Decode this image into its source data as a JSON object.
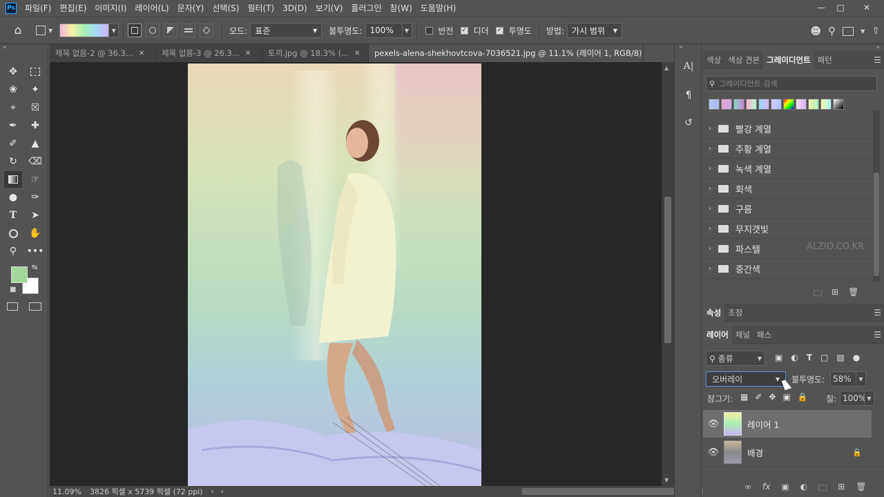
{
  "app": {
    "logo": "Ps"
  },
  "menu": [
    "파일(F)",
    "편집(E)",
    "이미지(I)",
    "레이어(L)",
    "문자(Y)",
    "선택(S)",
    "필터(T)",
    "3D(D)",
    "보기(V)",
    "플러그인",
    "창(W)",
    "도움말(H)"
  ],
  "options": {
    "mode_label": "모드:",
    "mode_value": "표준",
    "opacity_label": "불투명도:",
    "opacity_value": "100%",
    "reverse_label": "반전",
    "dither_label": "디더",
    "transparency_label": "투명도",
    "method_label": "방법:",
    "method_value": "가시 범위"
  },
  "tabs": [
    {
      "label": "제목 없음-2 @ 36.3...",
      "active": false
    },
    {
      "label": "제목 없음-3 @ 26.3...",
      "active": false
    },
    {
      "label": "토끼.jpg @ 18.3% (...",
      "active": false
    },
    {
      "label": "pexels-alena-shekhovtcova-7036521.jpg @ 11.1% (레이어 1, RGB/8) *",
      "active": true
    }
  ],
  "status": {
    "zoom": "11.09%",
    "info": "3826 픽셀 x 5739 픽셀 (72 ppi)"
  },
  "swatches_panel": {
    "tabs": [
      "색상",
      "색상 견본",
      "그레이디언트",
      "패턴"
    ],
    "active_tab": "그레이디언트",
    "search_placeholder": "그레이디언트 검색",
    "folders": [
      "빨강 계열",
      "주황 계열",
      "녹색 계열",
      "회색",
      "구름",
      "무지갯빛",
      "파스텔",
      "중간색"
    ],
    "watermark": "ALZIO.CO.KR"
  },
  "props_panel": {
    "tabs": [
      "속성",
      "조정"
    ],
    "active_tab": "속성"
  },
  "layers_panel": {
    "tabs": [
      "레이어",
      "채널",
      "패스"
    ],
    "active_tab": "레이어",
    "filter_label": "종류",
    "blend_mode": "오버레이",
    "opacity_label": "불투명도:",
    "opacity_value": "58%",
    "lock_label": "잠그기:",
    "fill_label": "칠:",
    "fill_value": "100%",
    "layers": [
      {
        "name": "레이어 1",
        "selected": true
      },
      {
        "name": "배경",
        "selected": false
      }
    ]
  },
  "colors": {
    "foreground": "#a4d79a",
    "background": "#ffffff",
    "accent": "#31a8ff"
  },
  "icons": {
    "home": "home-icon",
    "search": "search-icon",
    "share": "share-icon"
  }
}
